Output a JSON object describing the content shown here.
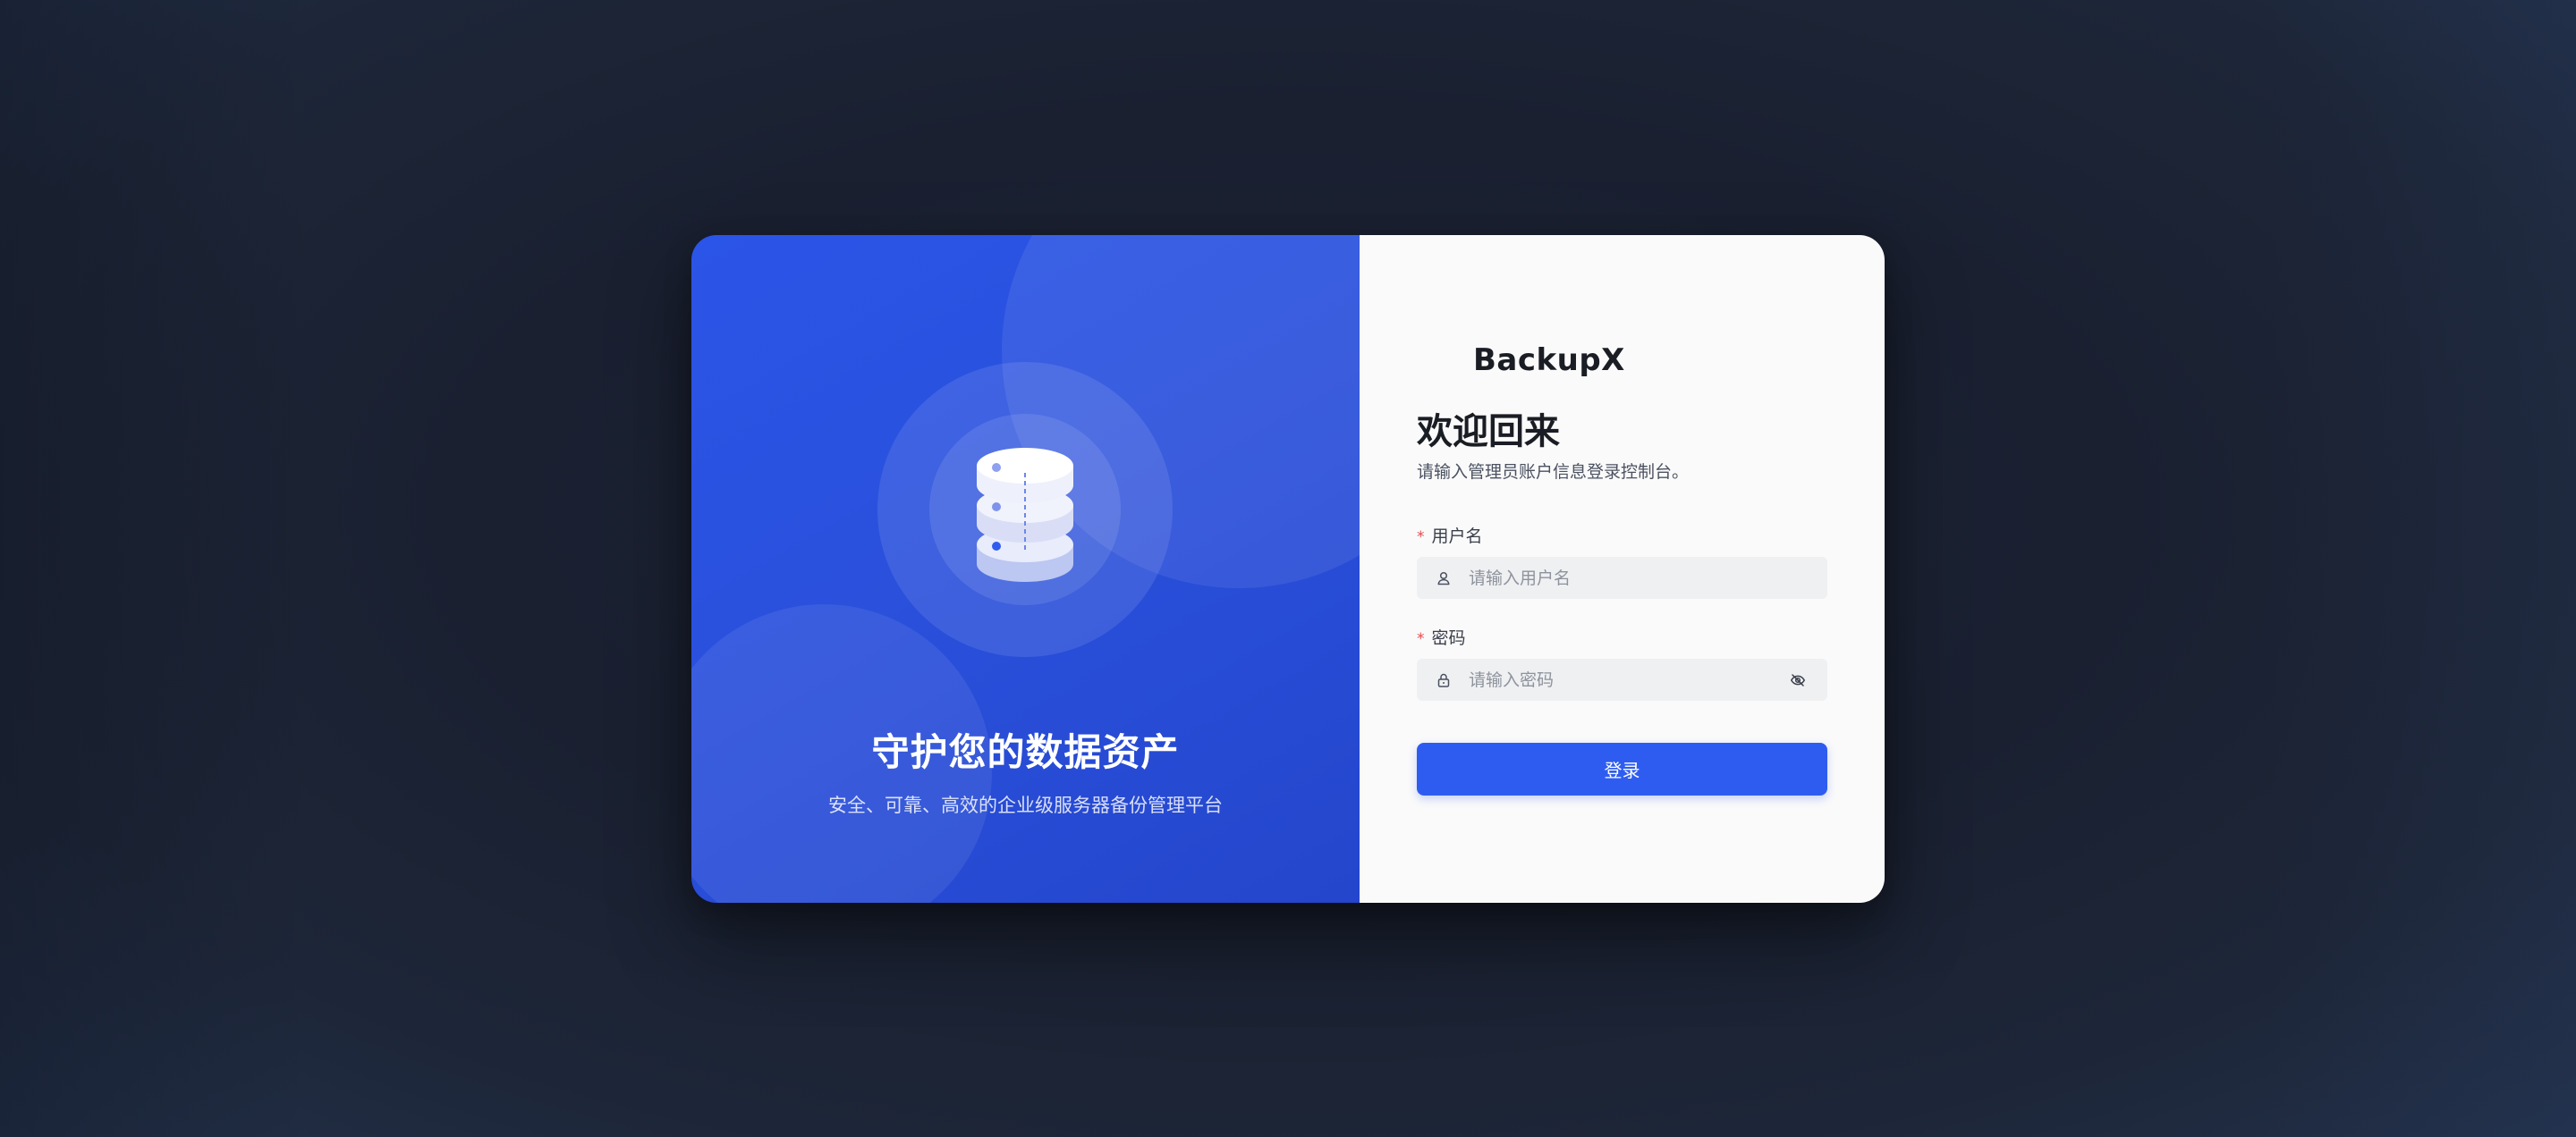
{
  "hero": {
    "title": "守护您的数据资产",
    "subtitle": "安全、可靠、高效的企业级服务器备份管理平台",
    "icon": "database-icon"
  },
  "brand": {
    "name": "BackupX",
    "icon": "logo-icon"
  },
  "form": {
    "welcome": "欢迎回来",
    "welcome_sub": "请输入管理员账户信息登录控制台。",
    "required_mark": "*",
    "username": {
      "label": "用户名",
      "placeholder": "请输入用户名",
      "value": "",
      "icon": "user-icon"
    },
    "password": {
      "label": "密码",
      "placeholder": "请输入密码",
      "value": "",
      "icon": "lock-icon",
      "toggle_icon": "eye-off-icon"
    },
    "submit_label": "登录"
  },
  "colors": {
    "accent": "#2f5cf0",
    "hero_bg": "#2a50dc",
    "page_bg": "#1a2030",
    "required": "#e5484d"
  }
}
